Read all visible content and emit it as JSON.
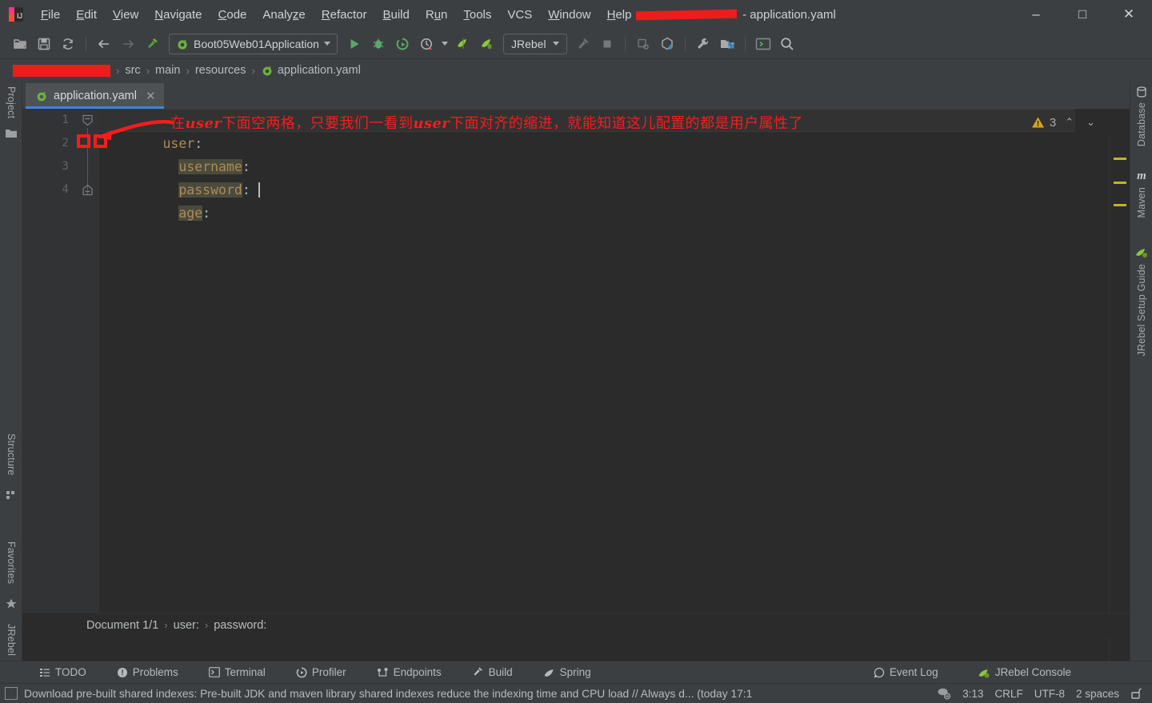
{
  "window": {
    "title_suffix": "- application.yaml",
    "title_redacted": true,
    "minimize_label": "–",
    "maximize_label": "□",
    "close_label": "✕"
  },
  "menubar": {
    "items": [
      {
        "label": "File",
        "mnemonic": "F"
      },
      {
        "label": "Edit",
        "mnemonic": "E"
      },
      {
        "label": "View",
        "mnemonic": "V"
      },
      {
        "label": "Navigate",
        "mnemonic": "N"
      },
      {
        "label": "Code",
        "mnemonic": "C"
      },
      {
        "label": "Analyze",
        "mnemonic": "z"
      },
      {
        "label": "Refactor",
        "mnemonic": "R"
      },
      {
        "label": "Build",
        "mnemonic": "B"
      },
      {
        "label": "Run",
        "mnemonic": "u"
      },
      {
        "label": "Tools",
        "mnemonic": "T"
      },
      {
        "label": "VCS",
        "mnemonic": ""
      },
      {
        "label": "Window",
        "mnemonic": "W"
      },
      {
        "label": "Help",
        "mnemonic": "H"
      }
    ]
  },
  "toolbar": {
    "run_configuration": "Boot05Web01Application",
    "jrebel_label": "JRebel",
    "icons": [
      "open-folder-icon",
      "save-all-icon",
      "sync-icon",
      "back-arrow-icon",
      "forward-arrow-icon",
      "build-hammer-icon",
      "run-icon",
      "debug-icon",
      "run-coverage-icon",
      "profile-icon",
      "jrebel-run-icon",
      "jrebel-debug-icon",
      "build-project-icon",
      "stop-icon",
      "attach-debugger-icon",
      "update-project-icon",
      "settings-wrench-icon",
      "project-structure-icon",
      "terminal-icon",
      "search-everywhere-icon"
    ]
  },
  "navbar": {
    "project_redacted": true,
    "crumbs": [
      "src",
      "main",
      "resources",
      "application.yaml"
    ],
    "separator": "›"
  },
  "left_strip": {
    "top_items": [
      {
        "label": "Project",
        "icon": "folder-icon"
      }
    ],
    "bottom_items": [
      {
        "label": "Structure",
        "icon": "structure-icon"
      },
      {
        "label": "Favorites",
        "icon": "star-icon"
      },
      {
        "label": "JRebel",
        "icon": "jrebel-leaf-icon"
      }
    ]
  },
  "right_strip": {
    "items": [
      {
        "label": "Database",
        "icon": "database-icon"
      },
      {
        "label": "Maven",
        "icon": "maven-m-icon"
      },
      {
        "label": "JRebel Setup Guide",
        "icon": "jrebel-leaf-icon"
      }
    ]
  },
  "editor": {
    "tab_label": "application.yaml",
    "tab_close": "✕",
    "line_numbers": [
      "1",
      "2",
      "3",
      "4"
    ],
    "code_lines": [
      {
        "indent": 0,
        "key": "user",
        "colon": ":",
        "highlight": false,
        "caret": false
      },
      {
        "indent": 2,
        "key": "username",
        "colon": ":",
        "highlight": true,
        "caret": false
      },
      {
        "indent": 2,
        "key": "password",
        "colon": ":",
        "highlight": true,
        "caret": true
      },
      {
        "indent": 2,
        "key": "age",
        "colon": ":",
        "highlight": true,
        "caret": false
      }
    ],
    "annotation": {
      "text_before": "在",
      "word1": "user",
      "text_mid": "下面空两格，只要我们一看到",
      "word2": "user",
      "text_after": "下面对齐的缩进，就能知道这儿配置的都是用户属性了",
      "color": "#f51d1d"
    },
    "warnings": {
      "count": "3",
      "icon": "warning-triangle-icon",
      "prev": "⌃",
      "next": "⌄",
      "color": "#d5a426"
    },
    "marker_color": "#bbb529",
    "doc_breadcrumb": [
      "Document 1/1",
      "user:",
      "password:"
    ],
    "doc_breadcrumb_sep": "›"
  },
  "toolwindow_bar": {
    "left": [
      {
        "label": "TODO",
        "icon": "todo-list-icon"
      },
      {
        "label": "Problems",
        "icon": "problems-icon"
      },
      {
        "label": "Terminal",
        "icon": "terminal-icon"
      },
      {
        "label": "Profiler",
        "icon": "profiler-icon"
      },
      {
        "label": "Endpoints",
        "icon": "endpoints-icon"
      },
      {
        "label": "Build",
        "icon": "build-hammer-icon"
      },
      {
        "label": "Spring",
        "icon": "spring-leaf-icon"
      }
    ],
    "right": [
      {
        "label": "Event Log",
        "icon": "event-log-icon"
      },
      {
        "label": "JRebel Console",
        "icon": "jrebel-leaf-icon"
      }
    ]
  },
  "status_bar": {
    "message": "Download pre-built shared indexes: Pre-built JDK and maven library shared indexes reduce the indexing time and CPU load // Always d... (today 17:1",
    "caret_position": "3:13",
    "line_separator": "CRLF",
    "encoding": "UTF-8",
    "indent": "2 spaces",
    "lock_icon": "unlocked-padlock-icon",
    "inspection_icon": "inspection-eye-icon"
  }
}
